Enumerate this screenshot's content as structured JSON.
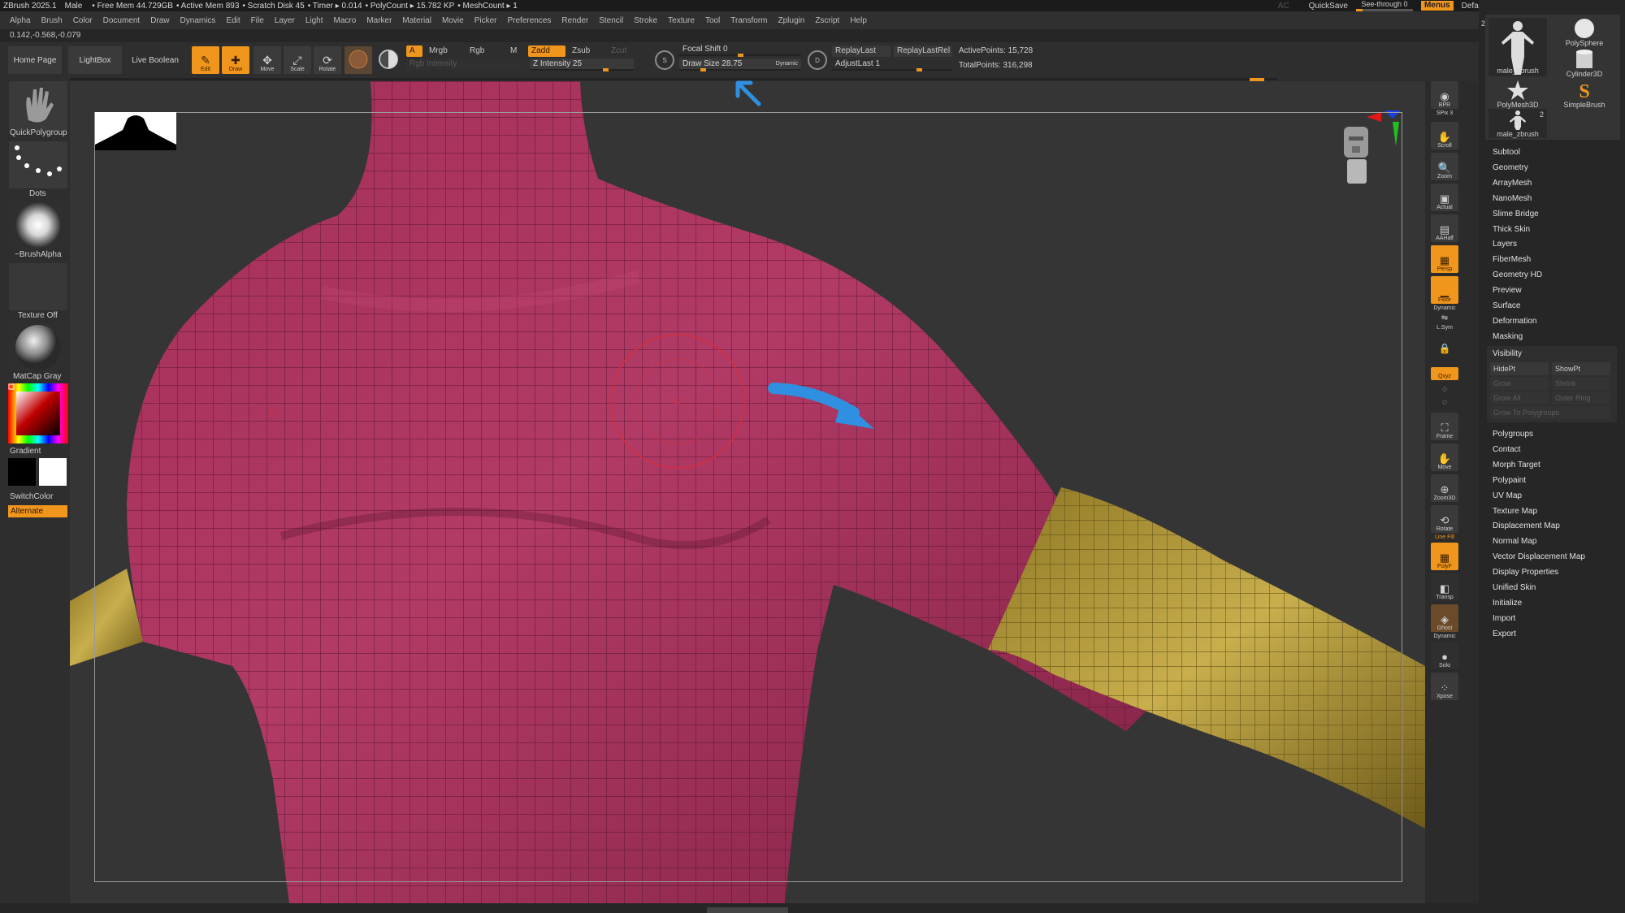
{
  "status_bar": {
    "app": "ZBrush 2025.1",
    "figure": "Male",
    "free_mem": "• Free Mem 44.729GB",
    "active_mem": "• Active Mem 893",
    "scratch_disk": "• Scratch Disk 45",
    "timer": "• Timer ▸ 0.014",
    "poly_count": "• PolyCount ▸ 15.782 KP",
    "mesh_count": "• MeshCount ▸ 1",
    "ac": "AC",
    "quicksave": "QuickSave",
    "see_through": "See-through",
    "see_through_value": "0",
    "see_through_level": 0.0,
    "menus": "Menus",
    "default_zscript": "DefaultZScript"
  },
  "menu_items": [
    "Alpha",
    "Brush",
    "Color",
    "Document",
    "Draw",
    "Dynamics",
    "Edit",
    "File",
    "Layer",
    "Light",
    "Macro",
    "Marker",
    "Material",
    "Movie",
    "Picker",
    "Preferences",
    "Render",
    "Stencil",
    "Stroke",
    "Texture",
    "Tool",
    "Transform",
    "Zplugin",
    "Zscript",
    "Help"
  ],
  "coords_readout": "0.142,-0.568,-0.079",
  "shelf": {
    "home_page": "Home Page",
    "lightbox": "LightBox",
    "live_boolean": "Live Boolean",
    "edit": "Edit",
    "draw": "Draw",
    "move": "Move",
    "scale": "Scale",
    "rotate": "Rotate",
    "a_label": "A",
    "mrgb": "Mrgb",
    "rgb": "Rgb",
    "m": "M",
    "rgb_intensity": "Rgb Intensity",
    "zadd": "Zadd",
    "zsub": "Zsub",
    "zcut": "Zcut",
    "z_intensity": "Z Intensity 25",
    "z_intensity_value": 25,
    "focal_shift": "Focal Shift 0",
    "focal_shift_value": 0,
    "draw_size": "Draw Size 28.75",
    "draw_size_value": 28.75,
    "dynamic": "Dynamic",
    "s_label": "S",
    "d_label": "D",
    "replay_last": "ReplayLast",
    "replay_last_rel": "ReplayLastRel",
    "adjust_last": "AdjustLast 1",
    "active_points": "ActivePoints: 15,728",
    "total_points": "TotalPoints: 316,298"
  },
  "left_tray": {
    "quick_polygroup": "QuickPolygroup",
    "dots": "Dots",
    "brush_alpha": "~BrushAlpha",
    "texture_off": "Texture Off",
    "matcap_gray": "MatCap Gray",
    "gradient": "Gradient",
    "switch_color": "SwitchColor",
    "alternate": "Alternate"
  },
  "right_dock": {
    "bpr": "BPR",
    "spix": "SPix 3",
    "scroll": "Scroll",
    "zoom": "Zoom",
    "actual": "Actual",
    "aahalf": "AAHalf",
    "persp": "Persp",
    "floor": "Floor",
    "dynamic": "Dynamic",
    "lsym": "L.Sym",
    "xyz": "Qxyz",
    "frame": "Frame",
    "move": "Move",
    "zoom3d": "Zoom3D",
    "rotate": "Rotate",
    "line_fill": "Line Fill",
    "polyf": "PolyF",
    "transp": "Transp",
    "ghost": "Ghost",
    "solo": "Solo",
    "xpose": "Xpose"
  },
  "tool_thumbs": [
    {
      "name": "male_zbrush",
      "badge": "2"
    },
    {
      "name": "PolySphere"
    },
    {
      "name": "Cylinder3D"
    },
    {
      "name": "PolyMesh3D"
    },
    {
      "name": "SimpleBrush"
    },
    {
      "name": "male_zbrush",
      "badge": "2"
    }
  ],
  "subtool_menu_top": [
    "Subtool",
    "Geometry",
    "ArrayMesh",
    "NanoMesh",
    "Slime Bridge",
    "Thick Skin",
    "Layers",
    "FiberMesh",
    "Geometry HD",
    "Preview",
    "Surface",
    "Deformation",
    "Masking"
  ],
  "visibility": {
    "title": "Visibility",
    "hidept": "HidePt",
    "showpt": "ShowPt",
    "grow": "Grow",
    "shrink": "Shrink",
    "grow_all": "Grow All",
    "outer_ring": "Outer Ring",
    "grow_to_polygroups": "Grow To Polygroups"
  },
  "subtool_menu_bottom": [
    "Polygroups",
    "Contact",
    "Morph Target",
    "Polypaint",
    "UV Map",
    "Texture Map",
    "Displacement Map",
    "Normal Map",
    "Vector Displacement Map",
    "Display Properties",
    "Unified Skin",
    "Initialize",
    "Import",
    "Export"
  ],
  "colors": {
    "accent": "#f0961c",
    "mesh_pink": "#a8335c",
    "mesh_gold": "#b49a3c",
    "annotation_blue": "#2f8fe0",
    "brush_ring": "#d03040"
  }
}
